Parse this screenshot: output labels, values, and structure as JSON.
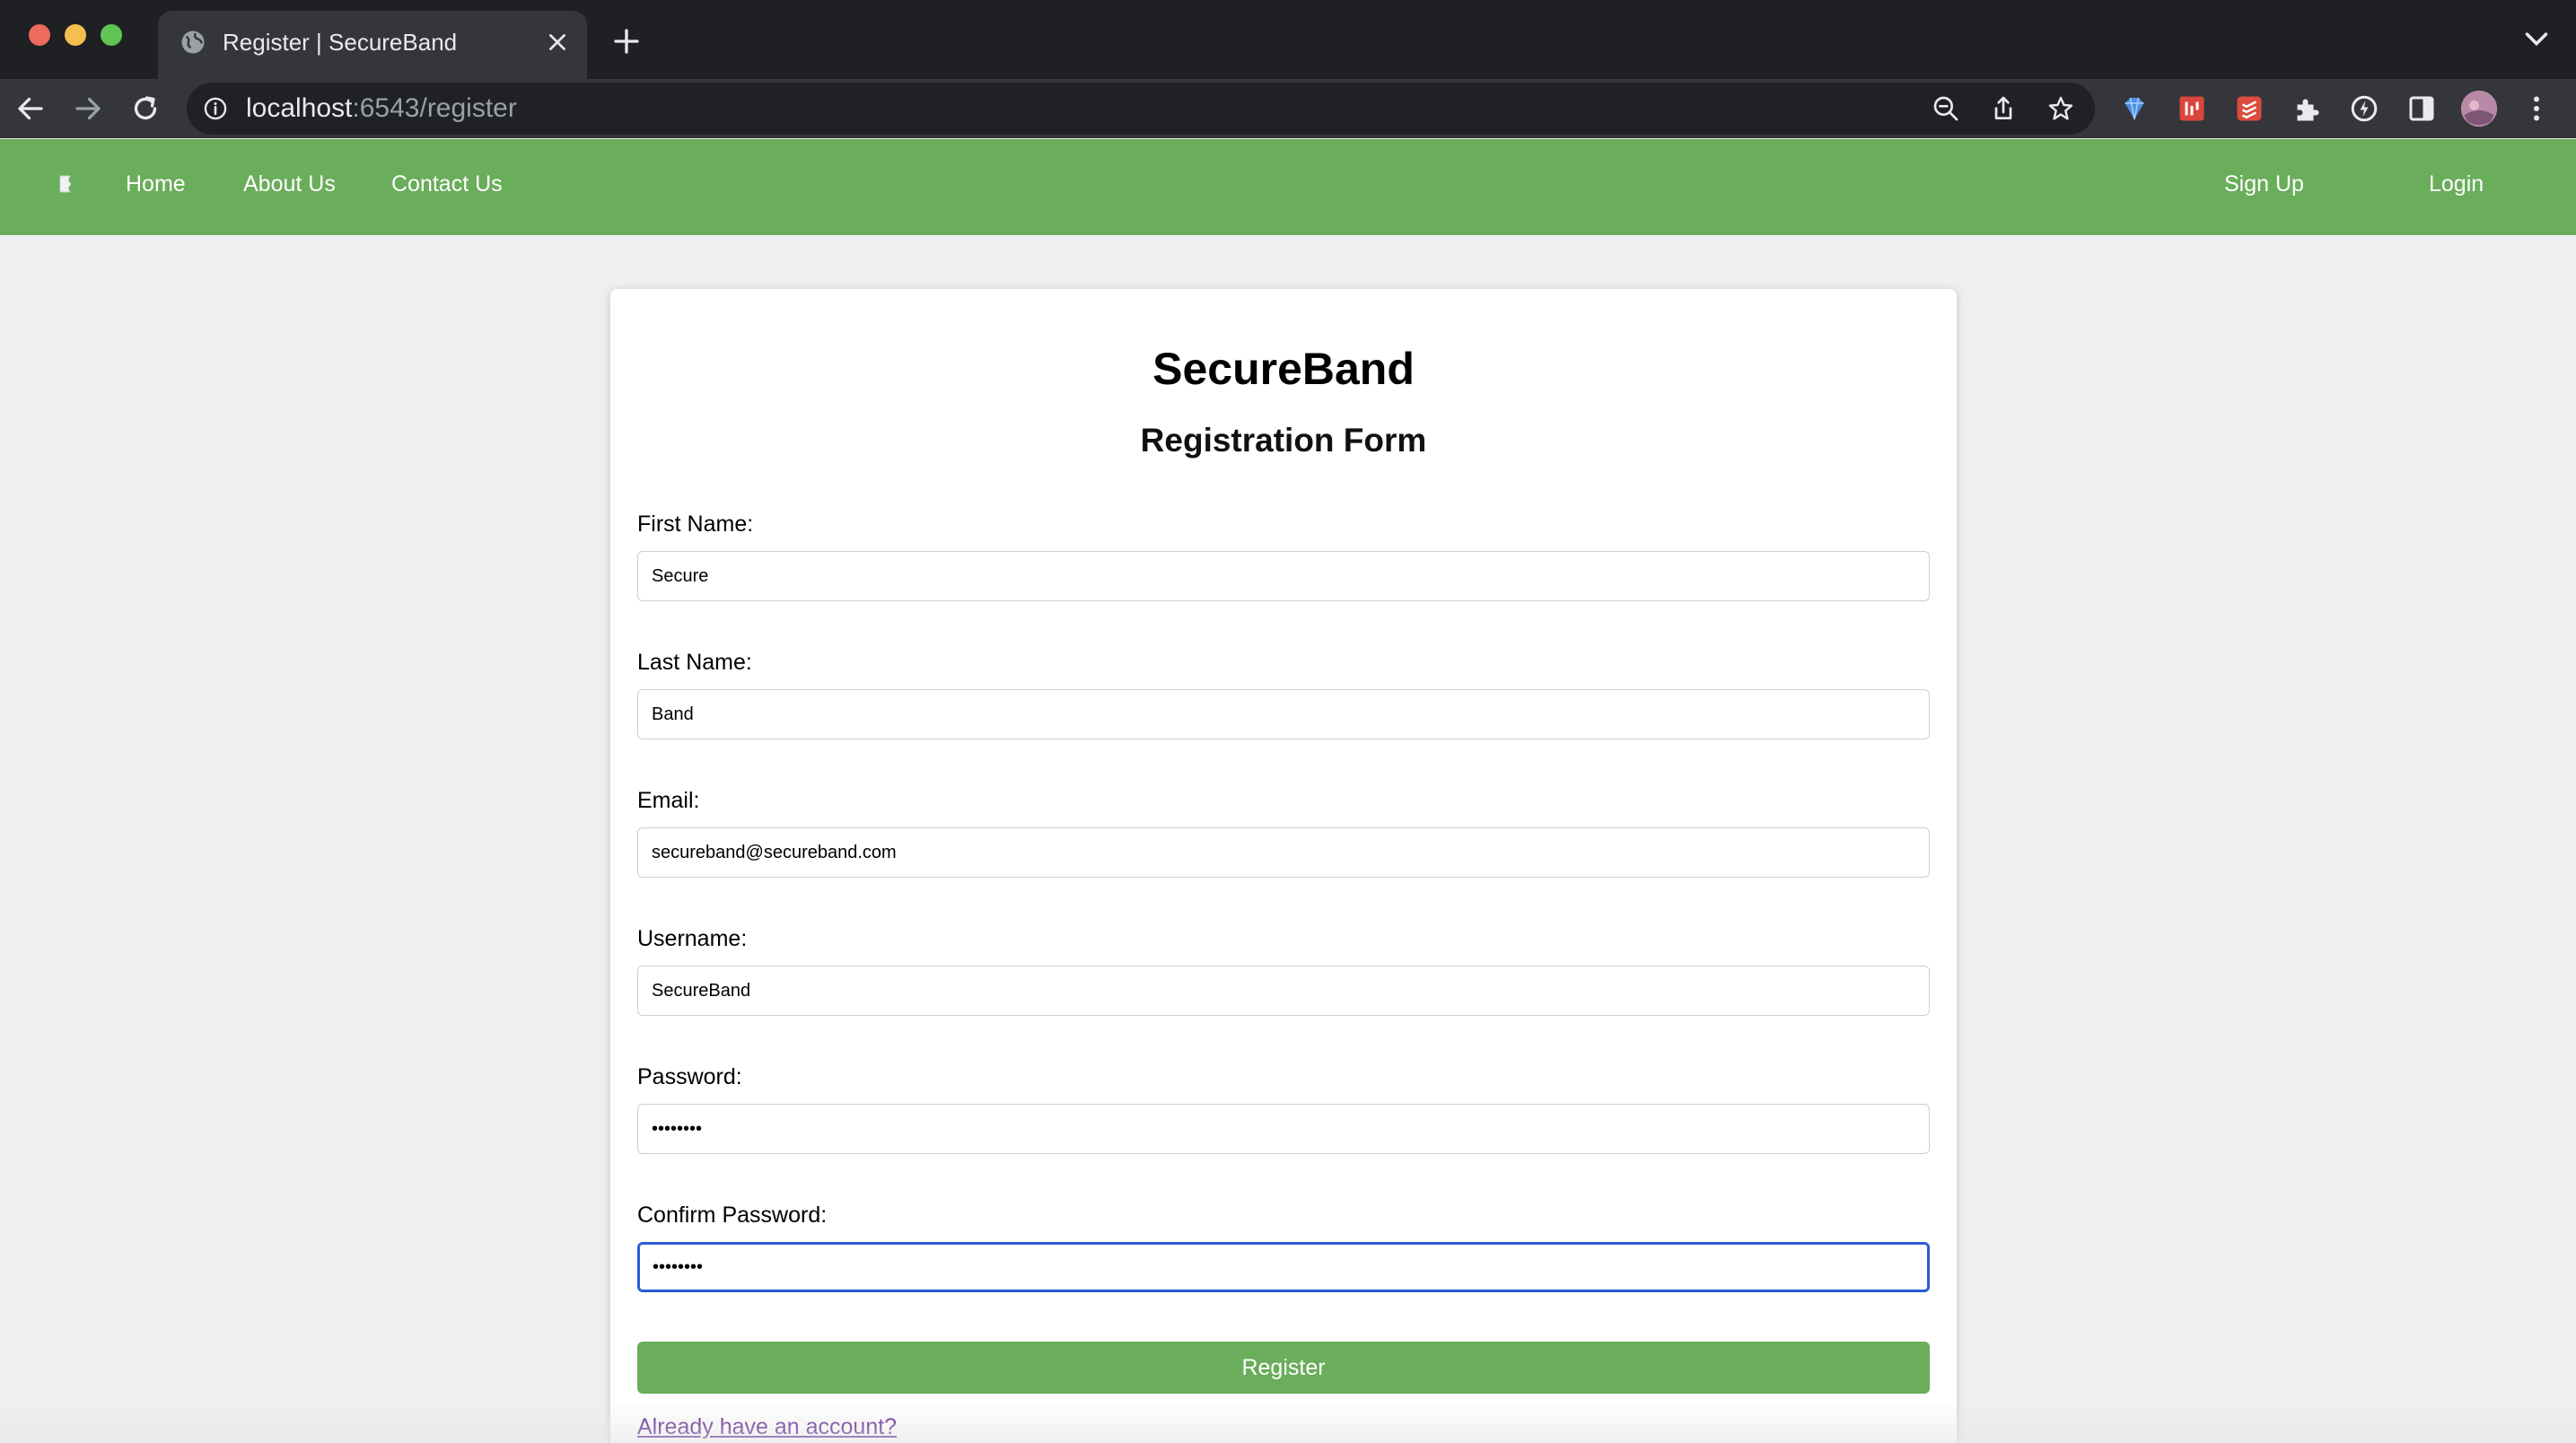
{
  "browser": {
    "tab_title": "Register | SecureBand",
    "url_host": "localhost",
    "url_path": ":6543/register"
  },
  "nav": {
    "links": [
      "Home",
      "About Us",
      "Contact Us"
    ],
    "signup": "Sign Up",
    "login": "Login"
  },
  "form": {
    "title": "SecureBand",
    "subtitle": "Registration Form",
    "fields": [
      {
        "label": "First Name:",
        "value": "Secure",
        "type": "text"
      },
      {
        "label": "Last Name:",
        "value": "Band",
        "type": "text"
      },
      {
        "label": "Email:",
        "value": "secureband@secureband.com",
        "type": "email"
      },
      {
        "label": "Username:",
        "value": "SecureBand",
        "type": "text"
      },
      {
        "label": "Password:",
        "value": "••••••••",
        "type": "password"
      },
      {
        "label": "Confirm Password:",
        "value": "••••••••",
        "type": "password"
      }
    ],
    "submit_label": "Register",
    "login_link": "Already have an account?"
  },
  "colors": {
    "nav_green": "#6aad5b",
    "focus_blue": "#2a5bd7",
    "link_purple": "#551a8b"
  },
  "icons": [
    "globe-icon",
    "close-icon",
    "plus-icon",
    "chevron-down-icon",
    "back-arrow-icon",
    "forward-arrow-icon",
    "reload-icon",
    "info-icon",
    "zoom-out-icon",
    "share-icon",
    "star-icon",
    "extension-diamond-icon",
    "extension-todoist-icon",
    "puzzle-icon",
    "sync-icon",
    "sidebar-icon",
    "avatar",
    "menu-kebab-icon"
  ]
}
